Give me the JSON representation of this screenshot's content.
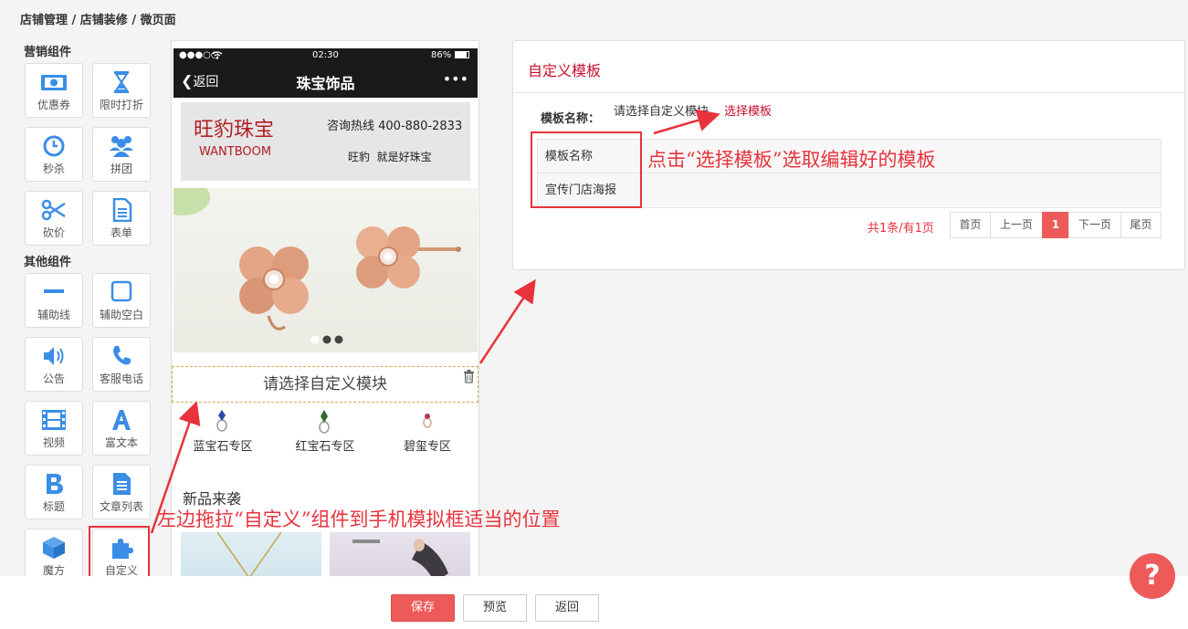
{
  "breadcrumb": "店铺管理 / 店铺装修 / 微页面",
  "palette": {
    "marketing_title": "营销组件",
    "other_title": "其他组件",
    "marketing": [
      {
        "label": "优惠券",
        "icon": "coupon-icon"
      },
      {
        "label": "限时打折",
        "icon": "hourglass-icon"
      },
      {
        "label": "秒杀",
        "icon": "clock-icon"
      },
      {
        "label": "拼团",
        "icon": "group-icon"
      },
      {
        "label": "砍价",
        "icon": "scissors-icon"
      },
      {
        "label": "表单",
        "icon": "form-icon"
      }
    ],
    "other": [
      {
        "label": "辅助线",
        "icon": "divider-line-icon"
      },
      {
        "label": "辅助空白",
        "icon": "blank-square-icon"
      },
      {
        "label": "公告",
        "icon": "speaker-icon"
      },
      {
        "label": "客服电话",
        "icon": "phone-icon"
      },
      {
        "label": "视频",
        "icon": "film-icon"
      },
      {
        "label": "富文本",
        "icon": "rich-text-icon"
      },
      {
        "label": "标题",
        "icon": "bold-title-icon"
      },
      {
        "label": "文章列表",
        "icon": "article-list-icon"
      },
      {
        "label": "魔方",
        "icon": "cube-icon"
      },
      {
        "label": "自定义",
        "icon": "puzzle-icon"
      }
    ]
  },
  "phone": {
    "carrier": "●●●○○",
    "time": "02:30",
    "battery": "86%",
    "back_label": "返回",
    "title": "珠宝饰品",
    "more": "•••",
    "shop_name_cn": "旺豹珠宝",
    "shop_name_en": "WANTBOOM",
    "hotline": "咨询热线 400-880-2833",
    "slogan": "旺豹  就是好珠宝",
    "custom_placeholder": "请选择自定义模块",
    "categories": [
      "蓝宝石专区",
      "红宝石专区",
      "碧玺专区"
    ],
    "new_title": "新品来袭"
  },
  "panel": {
    "title": "自定义模板",
    "name_label": "模板名称：",
    "name_value": "请选择自定义模块",
    "choose_link": "选择模板",
    "rows": [
      "模板名称",
      "宣传门店海报"
    ],
    "summary": "共1条/有1页",
    "pager": [
      "首页",
      "上一页",
      "1",
      "下一页",
      "尾页"
    ]
  },
  "annotations": {
    "right": "点击“选择模板”选取编辑好的模板",
    "left": "左边拖拉“自定义”组件到手机模拟框适当的位置"
  },
  "buttons": {
    "save": "保存",
    "preview": "预览",
    "back": "返回"
  },
  "help": "?",
  "colors": {
    "accent": "#ee5a5a",
    "annotation": "#e8333c",
    "icon": "#3a8ee6",
    "link": "#c8102e"
  }
}
